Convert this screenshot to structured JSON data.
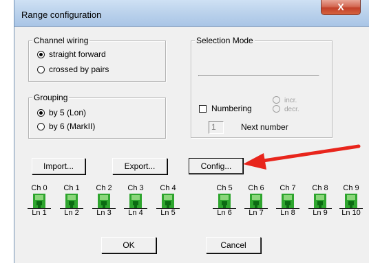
{
  "window": {
    "title": "Range configuration",
    "close_glyph": "X"
  },
  "channel_wiring": {
    "legend": "Channel wiring",
    "options": [
      {
        "label": "straight forward",
        "selected": true
      },
      {
        "label": "crossed by pairs",
        "selected": false
      }
    ]
  },
  "grouping": {
    "legend": "Grouping",
    "options": [
      {
        "label": "by 5 (Lon)",
        "selected": true
      },
      {
        "label": "by 6 (MarkII)",
        "selected": false
      }
    ]
  },
  "selection_mode": {
    "legend": "Selection Mode",
    "numbering_label": "Numbering",
    "numbering_checked": false,
    "incr_label": "incr.",
    "decr_label": "decr.",
    "next_number_value": "1",
    "next_number_label": "Next number"
  },
  "buttons": {
    "import": "Import...",
    "export": "Export...",
    "config": "Config...",
    "ok": "OK",
    "cancel": "Cancel"
  },
  "channels": [
    {
      "ch": "Ch 0",
      "ln": "Ln 1"
    },
    {
      "ch": "Ch 1",
      "ln": "Ln 2"
    },
    {
      "ch": "Ch 2",
      "ln": "Ln 3"
    },
    {
      "ch": "Ch 3",
      "ln": "Ln 4"
    },
    {
      "ch": "Ch 4",
      "ln": "Ln 5"
    },
    {
      "ch": "Ch 5",
      "ln": "Ln 6"
    },
    {
      "ch": "Ch 6",
      "ln": "Ln 7"
    },
    {
      "ch": "Ch 7",
      "ln": "Ln 8"
    },
    {
      "ch": "Ch 8",
      "ln": "Ln 9"
    },
    {
      "ch": "Ch 9",
      "ln": "Ln 10"
    }
  ],
  "icons": {
    "channel": "channel-connector-icon",
    "annotation": "red-arrow-annotation"
  },
  "colors": {
    "titlebar": "#bcd3ec",
    "close_button": "#c2412a",
    "dialog_face": "#f0f0f0",
    "channel_green": "#2ea52e",
    "arrow_red": "#e8251c"
  }
}
